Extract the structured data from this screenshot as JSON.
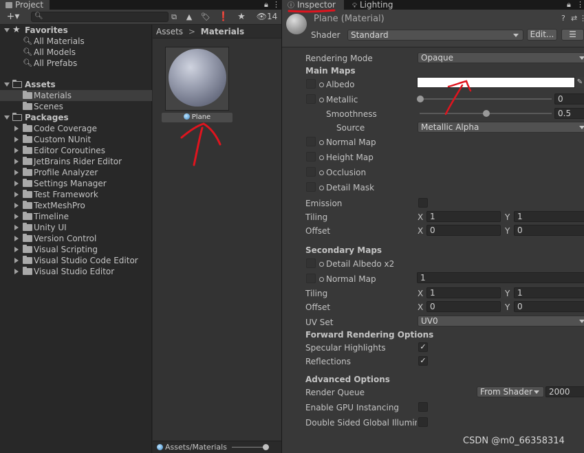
{
  "project": {
    "tab_label": "Project",
    "toolbar": {
      "add_label": "+▾",
      "search_placeholder": "",
      "hidden_count": "14"
    },
    "tree": {
      "favorites": {
        "label": "Favorites",
        "items": [
          "All Materials",
          "All Models",
          "All Prefabs"
        ]
      },
      "assets": {
        "label": "Assets",
        "items": [
          "Materials",
          "Scenes"
        ]
      },
      "packages": {
        "label": "Packages",
        "items": [
          "Code Coverage",
          "Custom NUnit",
          "Editor Coroutines",
          "JetBrains Rider Editor",
          "Profile Analyzer",
          "Settings Manager",
          "Test Framework",
          "TextMeshPro",
          "Timeline",
          "Unity UI",
          "Version Control",
          "Visual Scripting",
          "Visual Studio Code Editor",
          "Visual Studio Editor"
        ]
      }
    },
    "breadcrumb": {
      "root": "Assets",
      "separator": ">",
      "current": "Materials"
    },
    "asset": {
      "name": "Plane"
    },
    "footer_path": "Assets/Materials"
  },
  "inspector": {
    "tabs": {
      "inspector": "Inspector",
      "lighting": "Lighting"
    },
    "header": {
      "title": "Plane (Material)",
      "shader_label": "Shader",
      "shader_value": "Standard",
      "edit_label": "Edit...",
      "menu_label": "☰"
    },
    "rendering_mode": {
      "label": "Rendering Mode",
      "value": "Opaque"
    },
    "main_maps": {
      "title": "Main Maps",
      "albedo": "Albedo",
      "metallic": {
        "label": "Metallic",
        "value": "0"
      },
      "smoothness": {
        "label": "Smoothness",
        "value": "0.5",
        "level": 0.5
      },
      "source": {
        "label": "Source",
        "value": "Metallic Alpha"
      },
      "normal_map": "Normal Map",
      "height_map": "Height Map",
      "occlusion": "Occlusion",
      "detail_mask": "Detail Mask",
      "emission": "Emission",
      "tiling": {
        "label": "Tiling",
        "x_label": "X",
        "y_label": "Y",
        "x": "1",
        "y": "1"
      },
      "offset": {
        "label": "Offset",
        "x_label": "X",
        "y_label": "Y",
        "x": "0",
        "y": "0"
      }
    },
    "secondary_maps": {
      "title": "Secondary Maps",
      "detail_albedo": "Detail Albedo x2",
      "normal_map": {
        "label": "Normal Map",
        "value": "1"
      },
      "tiling": {
        "label": "Tiling",
        "x_label": "X",
        "y_label": "Y",
        "x": "1",
        "y": "1"
      },
      "offset": {
        "label": "Offset",
        "x_label": "X",
        "y_label": "Y",
        "x": "0",
        "y": "0"
      },
      "uv_set": {
        "label": "UV Set",
        "value": "UV0"
      }
    },
    "forward": {
      "title": "Forward Rendering Options",
      "specular": {
        "label": "Specular Highlights",
        "checked": true,
        "mark": "✓"
      },
      "reflections": {
        "label": "Reflections",
        "checked": true,
        "mark": "✓"
      }
    },
    "advanced": {
      "title": "Advanced Options",
      "render_queue": {
        "label": "Render Queue",
        "mode": "From Shader",
        "value": "2000"
      },
      "gpu_instancing": {
        "label": "Enable GPU Instancing",
        "checked": false
      },
      "double_sided": {
        "label": "Double Sided Global Illuminat",
        "checked": false
      }
    }
  },
  "watermark": "CSDN @m0_66358314",
  "colors": {
    "annotation_red": "#e0141e",
    "albedo_color": "#ffffff"
  }
}
